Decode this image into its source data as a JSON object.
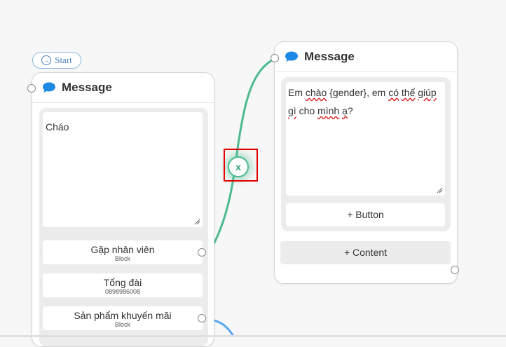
{
  "start": {
    "label": "Start"
  },
  "left_card": {
    "title": "Message",
    "text": "Cháo",
    "buttons": [
      {
        "title": "Gặp nhân viên",
        "sub": "Block"
      },
      {
        "title": "Tổng đài",
        "sub": "0898986008"
      },
      {
        "title": "Sản phẩm khuyến mãi",
        "sub": "Block"
      }
    ]
  },
  "right_card": {
    "title": "Message",
    "text_parts": [
      {
        "t": "Em ",
        "err": false
      },
      {
        "t": "chào",
        "err": true
      },
      {
        "t": " {gender}, em ",
        "err": false
      },
      {
        "t": "có",
        "err": true
      },
      {
        "t": " ",
        "err": false
      },
      {
        "t": "thể",
        "err": true
      },
      {
        "t": " ",
        "err": false
      },
      {
        "t": "giúp",
        "err": true
      },
      {
        "t": " ",
        "err": false
      },
      {
        "t": "gì",
        "err": true
      },
      {
        "t": " cho ",
        "err": false
      },
      {
        "t": "mình",
        "err": true
      },
      {
        "t": " ",
        "err": false
      },
      {
        "t": "ạ",
        "err": true
      },
      {
        "t": "?",
        "err": false
      }
    ],
    "add_button_label": "+ Button",
    "add_content_label": "+ Content"
  },
  "connector": {
    "delete_label": "x"
  },
  "colors": {
    "accent_green": "#4dba8f",
    "link_blue": "#4a7fc0",
    "message_icon": "#1e88e5",
    "highlight_red": "#e00000"
  }
}
